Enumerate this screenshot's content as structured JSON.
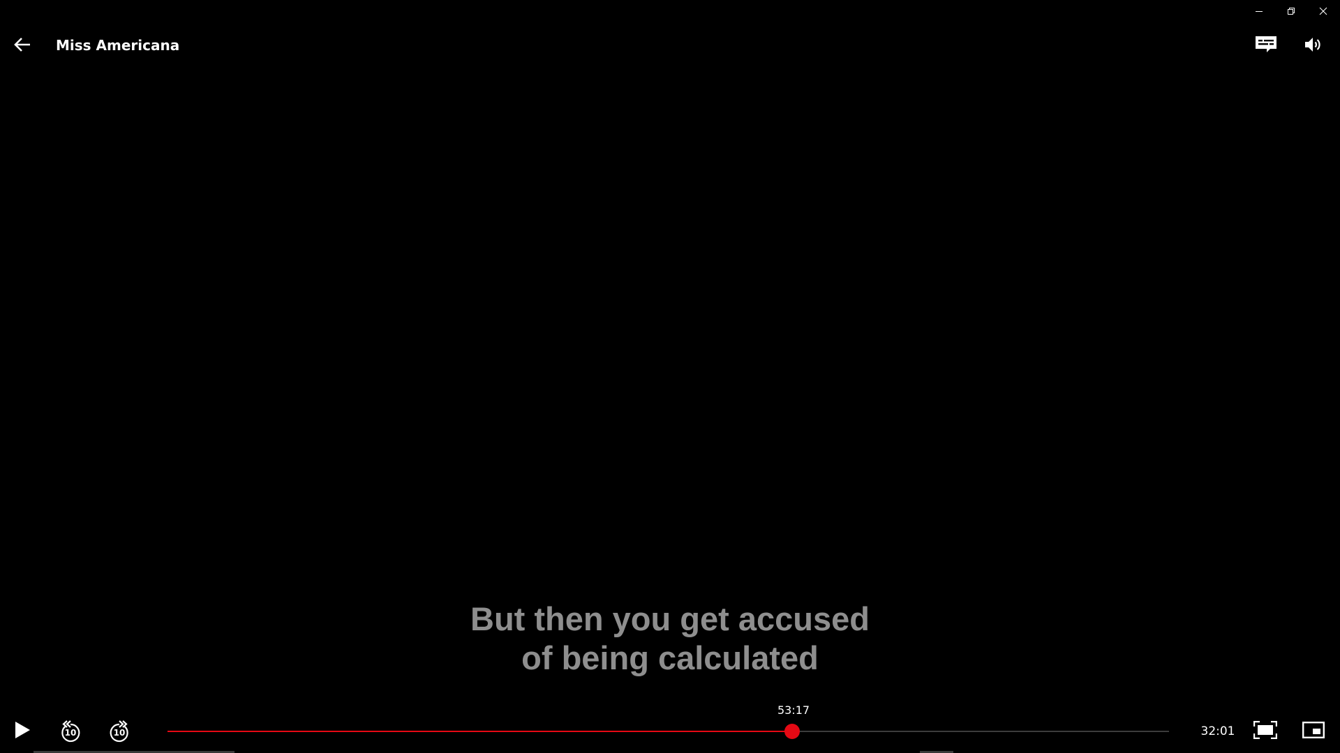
{
  "window": {
    "controls": [
      {
        "name": "minimize-button",
        "icon": "minimize-icon"
      },
      {
        "name": "restore-button",
        "icon": "restore-icon"
      },
      {
        "name": "close-window-button",
        "icon": "close-icon"
      }
    ]
  },
  "header": {
    "back_icon": "arrow-left-icon",
    "title": "Miss Americana",
    "subtitles_icon": "subtitles-icon",
    "volume_icon": "volume-icon"
  },
  "subtitle": {
    "line1": "But then you get accused",
    "line2": "of being calculated"
  },
  "controls": {
    "play_icon": "play-icon",
    "rewind_icon": "rewind-10-icon",
    "forward_icon": "forward-10-icon",
    "rewind_seconds": "10",
    "forward_seconds": "10",
    "hover_time": "53:17",
    "time_remaining": "32:01",
    "progress_fraction": 0.624,
    "fullscreen_icon": "fullscreen-icon",
    "pip_icon": "picture-in-picture-icon"
  },
  "colors": {
    "background": "#000000",
    "accent": "#e50914",
    "subtitle_text": "#8e8e8e",
    "track": "#3c3c3c"
  }
}
